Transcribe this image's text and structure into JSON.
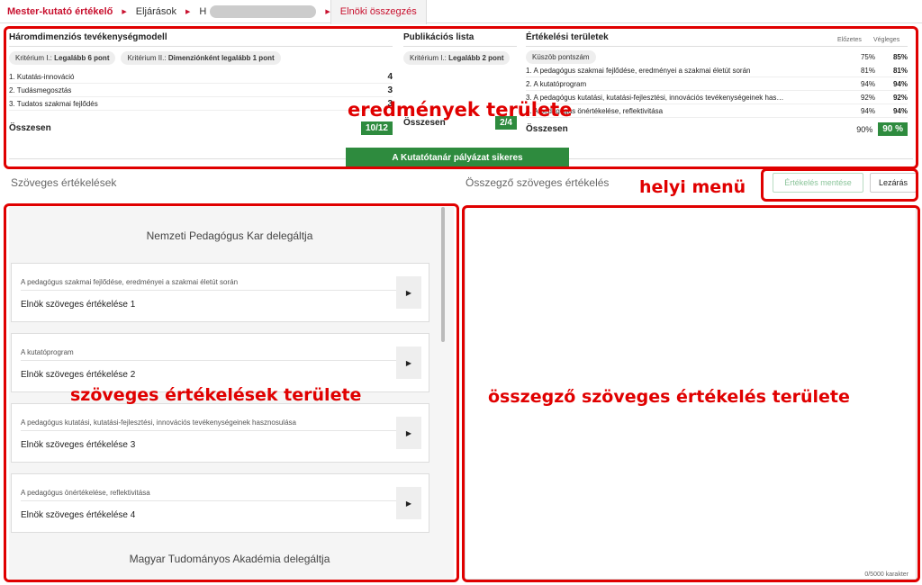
{
  "breadcrumb": {
    "items": [
      "Mester-kutató értékelő",
      "Eljárások",
      "H",
      "Elnöki összegzés"
    ]
  },
  "results": {
    "model": {
      "title": "Háromdimenziós tevékenységmodell",
      "chips": [
        {
          "prefix": "Kritérium I.:",
          "value": "Legalább 6 pont"
        },
        {
          "prefix": "Kritérium II.:",
          "value": "Dimenziónként legalább 1 pont"
        }
      ],
      "rows": [
        {
          "label": "1. Kutatás-innováció",
          "value": "4"
        },
        {
          "label": "2. Tudásmegosztás",
          "value": "3"
        },
        {
          "label": "3. Tudatos szakmai fejlődés",
          "value": "3"
        }
      ],
      "total_label": "Összesen",
      "total_value": "10/12"
    },
    "publications": {
      "title": "Publikációs lista",
      "chip": {
        "prefix": "Kritérium I.:",
        "value": "Legalább 2 pont"
      },
      "total_label": "Összesen",
      "total_value": "2/4"
    },
    "areas": {
      "title": "Értékelési területek",
      "col_prev": "Előzetes",
      "col_final": "Végleges",
      "threshold": {
        "label": "Küszöb pontszám",
        "prev": "75%",
        "final": "85%"
      },
      "rows": [
        {
          "label": "1. A pedagógus szakmai fejlődése, eredményei a szakmai életút során",
          "prev": "81%",
          "final": "81%"
        },
        {
          "label": "2. A kutatóprogram",
          "prev": "94%",
          "final": "94%"
        },
        {
          "label": "3. A pedagógus kutatási, kutatási-fejlesztési, innovációs tevékenységeinek has…",
          "prev": "92%",
          "final": "92%"
        },
        {
          "label": "4. A pedagógus önértékelése, reflektivitása",
          "prev": "94%",
          "final": "94%"
        }
      ],
      "total_label": "Összesen",
      "total_prev": "90%",
      "total_final": "90 %"
    },
    "success_label": "A Kutatótanár pályázat sikeres"
  },
  "sections": {
    "text_evals_title": "Szöveges értékelések",
    "summary_title": "Összegző szöveges értékelés",
    "save_label": "Értékelés mentése",
    "close_label": "Lezárás"
  },
  "groups": [
    {
      "title": "Nemzeti Pedagógus Kar delegáltja",
      "cards": [
        {
          "area": "A pedagógus szakmai fejlődése, eredményei a szakmai életút során",
          "name": "Elnök szöveges értékelése 1"
        },
        {
          "area": "A kutatóprogram",
          "name": "Elnök szöveges értékelése 2"
        },
        {
          "area": "A pedagógus kutatási, kutatási-fejlesztési, innovációs tevékenységeinek hasznosulása",
          "name": "Elnök szöveges értékelése 3"
        },
        {
          "area": "A pedagógus önértékelése, reflektivitása",
          "name": "Elnök szöveges értékelése 4"
        }
      ]
    },
    {
      "title": "Magyar Tudományos Akadémia delegáltja"
    }
  ],
  "summary": {
    "char_count": "0/5000 karakter"
  },
  "annotations": {
    "results_area": "eredmények területe",
    "local_menu": "helyi menü",
    "text_evals_area": "szöveges értékelések területe",
    "summary_area": "összegző szöveges értékelés területe"
  },
  "colors": {
    "brand_red": "#c8102e",
    "success_green": "#2e8b3e",
    "annotation_red": "#e00000"
  }
}
